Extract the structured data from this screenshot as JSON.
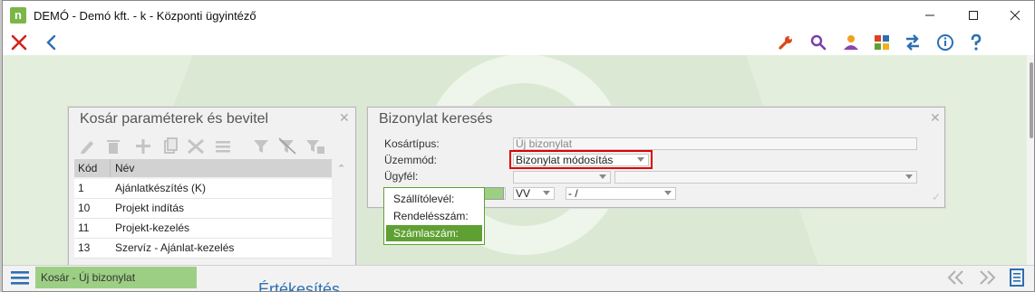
{
  "window": {
    "logo_letter": "n",
    "title": "DEMÓ - Demó kft. - k - Központi ügyintéző"
  },
  "toolbar": {
    "close_icon": "close-icon",
    "back_icon": "back-icon",
    "right_icons": [
      "wrench-icon",
      "search-icon",
      "user-icon",
      "apps-grid-icon",
      "transfer-icon",
      "info-icon",
      "help-icon"
    ]
  },
  "basket_panel": {
    "title": "Kosár paraméterek és bevitel",
    "close": "✕",
    "tools": [
      "edit-icon",
      "delete-icon",
      "add-icon",
      "copy-icon",
      "tools-icon",
      "list-icon",
      "filter-icon",
      "clear-filter-icon",
      "filter-settings-icon"
    ],
    "columns": [
      "Kód",
      "Név"
    ],
    "rows": [
      {
        "code": "1",
        "name": "Ajánlatkészítés (K)"
      },
      {
        "code": "10",
        "name": "Projekt indítás"
      },
      {
        "code": "11",
        "name": "Projekt-kezelés"
      },
      {
        "code": "13",
        "name": "Szervíz - Ajánlat-kezelés"
      }
    ]
  },
  "search_panel": {
    "title": "Bizonylat keresés",
    "close": "✕",
    "basket_type_label": "Kosártípus:",
    "basket_type_value": "Új bizonylat",
    "mode_label": "Üzemmód:",
    "mode_value": "Bizonylat módosítás",
    "client_label": "Ügyfél:",
    "year_value": "VV",
    "period_value": "- /",
    "ok_mark": "✓"
  },
  "popup": {
    "items": [
      "Szállítólevél:",
      "Rendelésszám:",
      "Számlaszám:"
    ],
    "selected_index": 2
  },
  "statusbar": {
    "tab_label": "Kosár - Új bizonylat",
    "behind_text": "Értékesítés"
  },
  "colors": {
    "accent_green": "#5fa032",
    "content_bg": "#dbe9d4",
    "highlight_red": "#e00000",
    "nav_blue": "#2c6fb3"
  }
}
